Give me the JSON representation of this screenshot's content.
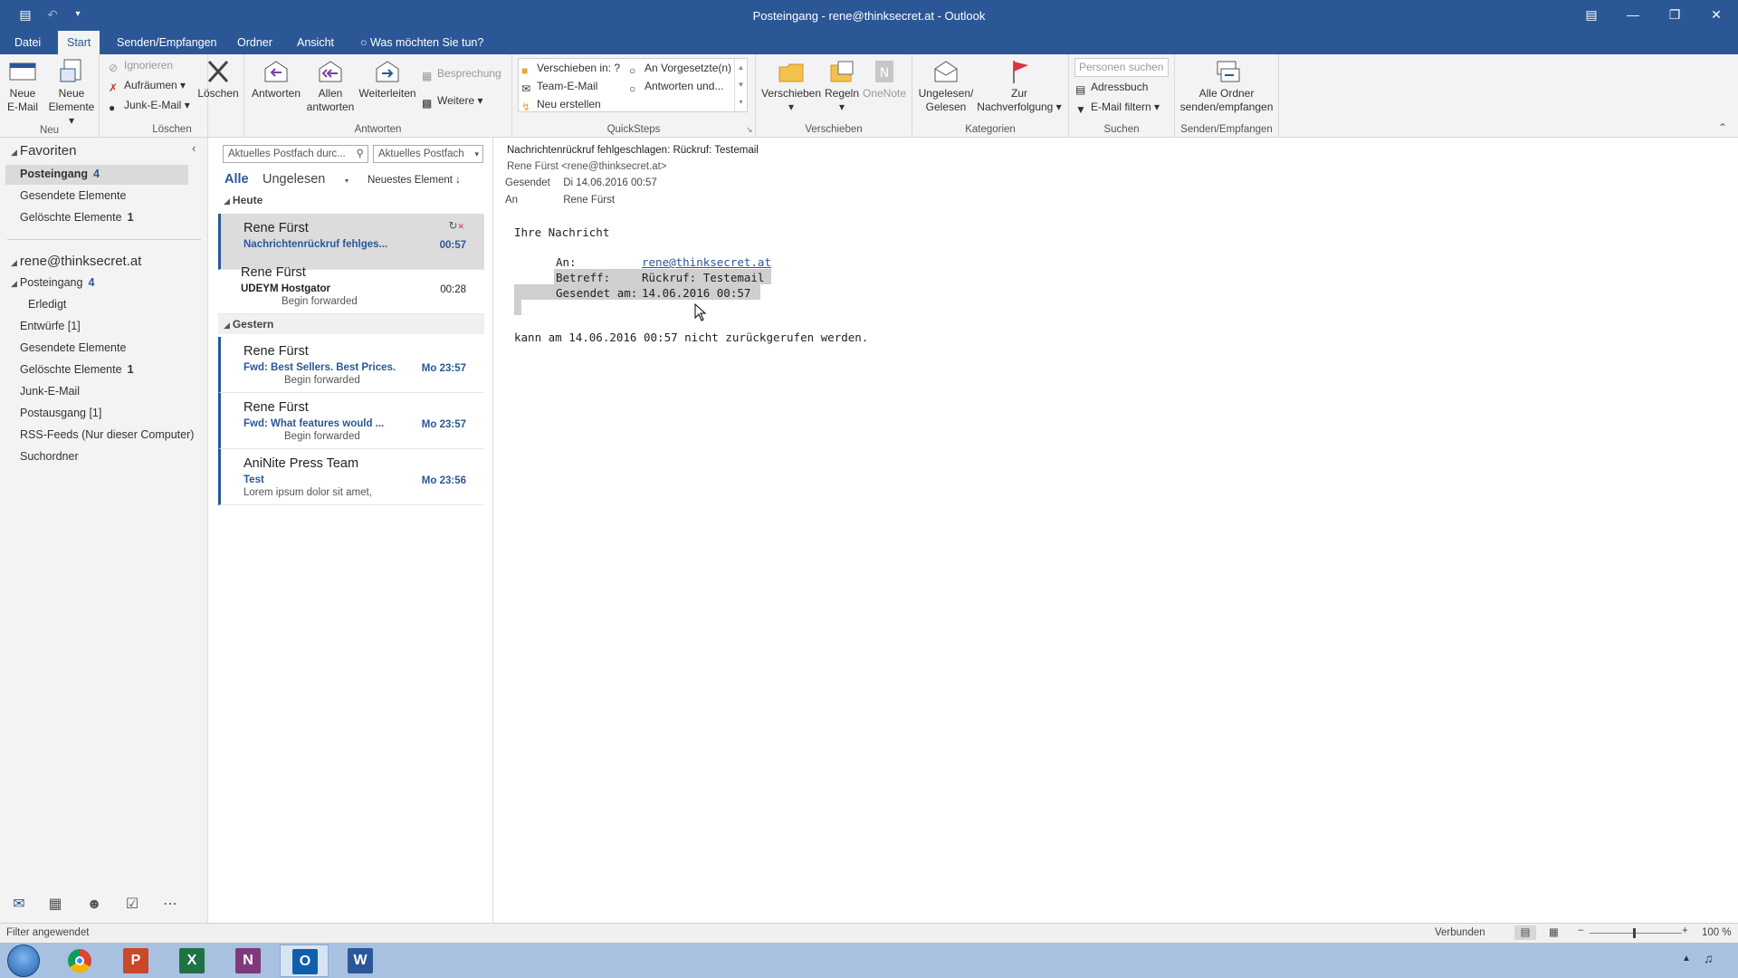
{
  "window": {
    "title": "Posteingang - rene@thinksecret.at - Outlook",
    "controls": [
      "ribbon-display-icon",
      "minimize-icon",
      "restore-icon",
      "close-icon"
    ]
  },
  "menu": {
    "tabs": [
      "Datei",
      "Start",
      "Senden/Empfangen",
      "Ordner",
      "Ansicht"
    ],
    "active": "Start",
    "tell_me": "Was möchten Sie tun?"
  },
  "ribbon": {
    "neu": {
      "label": "Neu",
      "new_email": [
        "Neue",
        "E-Mail"
      ],
      "new_items": [
        "Neue",
        "Elemente"
      ]
    },
    "loeschen": {
      "label": "Löschen",
      "ignore": "Ignorieren",
      "cleanup": "Aufräumen",
      "junk": "Junk-E-Mail",
      "delete": "Löschen"
    },
    "antworten": {
      "label": "Antworten",
      "reply": "Antworten",
      "reply_all": [
        "Allen",
        "antworten"
      ],
      "forward": "Weiterleiten",
      "meeting": "Besprechung",
      "more": "Weitere"
    },
    "quicksteps": {
      "label": "QuickSteps",
      "items": [
        "Verschieben in: ?",
        "An Vorgesetzte(n)",
        "Team-E-Mail",
        "Antworten und...",
        "Neu erstellen"
      ]
    },
    "verschieben": {
      "label": "Verschieben",
      "move": "Verschieben",
      "rules": "Regeln",
      "onenote": "OneNote"
    },
    "kategorien": {
      "label": "Kategorien",
      "unread_read": [
        "Ungelesen/",
        "Gelesen"
      ],
      "followup": [
        "Zur",
        "Nachverfolgung"
      ]
    },
    "suchen": {
      "label": "Suchen",
      "search_people": "Personen suchen",
      "address_book": "Adressbuch",
      "filter_email": "E-Mail filtern"
    },
    "sendrecv": {
      "label": "Senden/Empfangen",
      "all_folders": [
        "Alle Ordner",
        "senden/empfangen"
      ]
    }
  },
  "nav": {
    "favorites_header": "Favoriten",
    "favorites": [
      {
        "label": "Posteingang",
        "count": "4",
        "selected": true
      },
      {
        "label": "Gesendete Elemente",
        "count": ""
      },
      {
        "label": "Gelöschte Elemente",
        "count": "1"
      }
    ],
    "account": "rene@thinksecret.at",
    "folders": [
      {
        "label": "Posteingang",
        "count": "4",
        "expanded": true
      },
      {
        "label": "Erledigt",
        "count": "",
        "sub": true
      },
      {
        "label": "Entwürfe [1]",
        "count": ""
      },
      {
        "label": "Gesendete Elemente",
        "count": ""
      },
      {
        "label": "Gelöschte Elemente",
        "count": "1"
      },
      {
        "label": "Junk-E-Mail",
        "count": ""
      },
      {
        "label": "Postausgang [1]",
        "count": ""
      },
      {
        "label": "RSS-Feeds (Nur dieser Computer)",
        "count": ""
      },
      {
        "label": "Suchordner",
        "count": ""
      }
    ]
  },
  "list": {
    "search_placeholder": "Aktuelles Postfach durc...",
    "scope": "Aktuelles Postfach",
    "filter_all": "Alle",
    "filter_unread": "Ungelesen",
    "sort": "Neuestes Element",
    "groups": [
      {
        "name": "Heute"
      },
      {
        "name": "Gestern"
      }
    ],
    "messages": [
      {
        "from": "Rene Fürst",
        "subject": "Nachrichtenrückruf fehlges...",
        "time": "00:57",
        "preview": "",
        "unread": true,
        "selected": true
      },
      {
        "from": "Rene Fürst",
        "subject": "UDEYM Hostgator",
        "time": "00:28",
        "preview": "Begin forwarded",
        "unread": false
      },
      {
        "from": "Rene Fürst",
        "subject": "Fwd: Best Sellers. Best Prices.",
        "time": "Mo 23:57",
        "preview": "Begin forwarded",
        "unread": true
      },
      {
        "from": "Rene Fürst",
        "subject": "Fwd: What features would ...",
        "time": "Mo 23:57",
        "preview": "Begin forwarded",
        "unread": true
      },
      {
        "from": "AniNite Press Team",
        "subject": "Test",
        "time": "Mo 23:56",
        "preview": "Lorem ipsum dolor sit amet,",
        "unread": true
      }
    ]
  },
  "reading": {
    "subject": "Nachrichtenrückruf fehlgeschlagen: Rückruf: Testemail",
    "sender": "Rene Fürst <rene@thinksecret.at>",
    "sent_label": "Gesendet",
    "sent_value": "Di 14.06.2016 00:57",
    "to_label": "An",
    "to_value": "Rene Fürst",
    "body_intro": "Ihre Nachricht",
    "field_to_label": "An:",
    "field_to_value": "rene@thinksecret.at",
    "field_subject_label": "Betreff:",
    "field_subject_value": "Rückruf: Testemail",
    "field_sent_label": "Gesendet am:",
    "field_sent_value": "14.06.2016 00:57",
    "body_outro": "kann am 14.06.2016 00:57 nicht zurückgerufen werden."
  },
  "status": {
    "left": "Filter angewendet",
    "connected": "Verbunden",
    "zoom": "100 %"
  },
  "taskbar": {
    "apps": [
      "start-orb-icon",
      "chrome-icon",
      "powerpoint-icon",
      "excel-icon",
      "onenote-icon",
      "outlook-icon",
      "word-icon"
    ],
    "active": "outlook-icon"
  },
  "colors": {
    "accent": "#2b5797",
    "ribbon_bg": "#f3f3f3",
    "selection": "#dcdcdc",
    "taskbar": "#a9c1e1"
  }
}
